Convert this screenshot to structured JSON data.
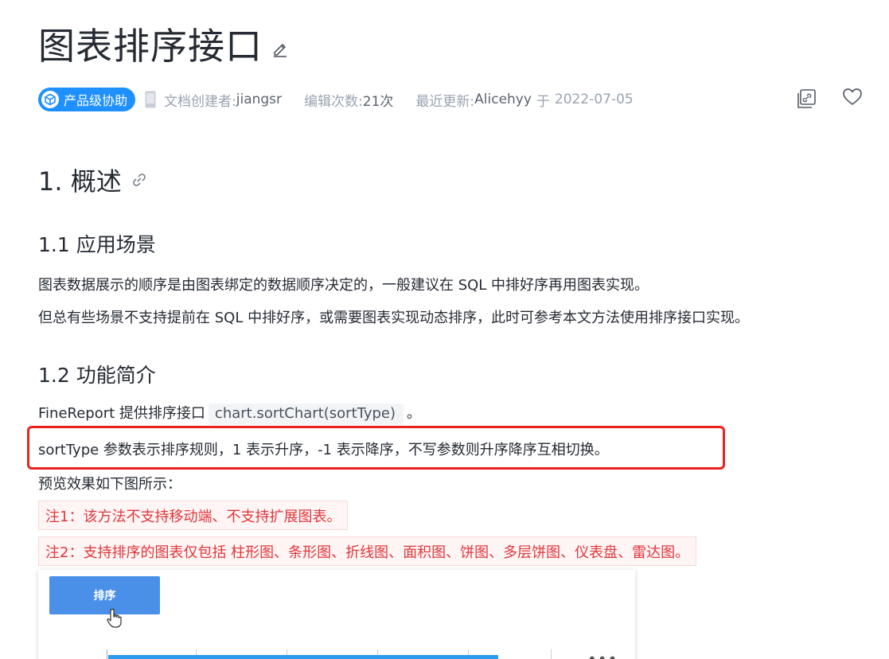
{
  "page": {
    "title": "图表排序接口"
  },
  "meta": {
    "badge_label": "产品级协助",
    "creator_label": "文档创建者:",
    "creator_value": "jiangsr",
    "edits_label": "编辑次数:",
    "edits_value": "21次",
    "updated_label": "最近更新:",
    "updated_user": "Alicehyy",
    "updated_on_label": "于",
    "updated_date": "2022-07-05"
  },
  "sections": {
    "h1": "1. 概述",
    "h1_1": "1.1 应用场景",
    "p1": "图表数据展示的顺序是由图表绑定的数据顺序决定的，一般建议在 SQL 中排好序再用图表实现。",
    "p2": "但总有些场景不支持提前在 SQL 中排好序，或需要图表实现动态排序，此时可参考本文方法使用排序接口实现。",
    "h1_2": "1.2 功能简介",
    "p3_prefix": "FineReport 提供排序接口",
    "p3_code": "chart.sortChart(sortType)",
    "p3_suffix": "。",
    "p4": "sortType 参数表示排序规则，1 表示升序，-1 表示降序，不写参数则升序降序互相切换。",
    "p5": "预览效果如下图所示：",
    "note1": "注1：该方法不支持移动端、不支持扩展图表。",
    "note2": "注2：支持排序的图表仅包括 柱形图、条形图、折线图、面积图、饼图、多层饼图、仪表盘、雷达图。"
  },
  "preview": {
    "sort_button_label": "排序",
    "more_label": "•••"
  },
  "colors": {
    "accent": "#1e90ff",
    "note_text": "#e0363a",
    "highlight_border": "#e8231f"
  }
}
